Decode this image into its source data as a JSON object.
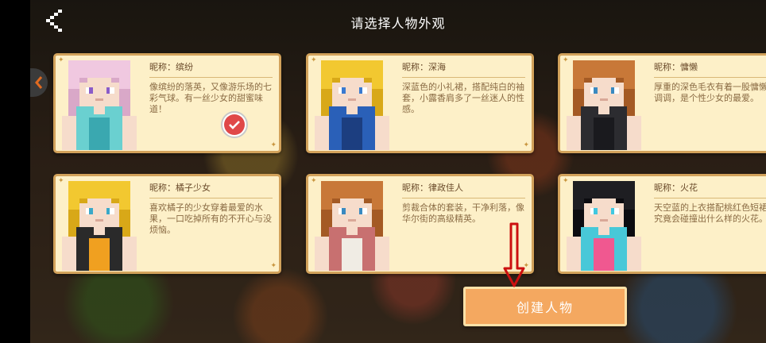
{
  "header": {
    "title": "请选择人物外观"
  },
  "characters": [
    {
      "nick": "昵称：缤纷",
      "desc": "像缤纷的落英，又像游乐场的七彩气球。有一丝少女的甜蜜味道！",
      "selected": true,
      "hair": "#f0c8e0",
      "hair_dark": "#d9a8c8",
      "skin": "#f6dccb",
      "eye": "#8a5cc8",
      "top": "#6ad0d0",
      "top_dark": "#3aa8b0"
    },
    {
      "nick": "昵称：深海",
      "desc": "深蓝色的小礼裙，搭配纯白的袖套，小露香肩多了一丝迷人的性感。",
      "selected": false,
      "hair": "#f2c830",
      "hair_dark": "#d8a818",
      "skin": "#f6dccb",
      "eye": "#3a7ad0",
      "top": "#2a60b8",
      "top_dark": "#1c3e80"
    },
    {
      "nick": "昵称：慵懒",
      "desc": "厚重的深色毛衣有着一股慵懒的调调，是个性少女的最爱。",
      "selected": false,
      "hair": "#c87838",
      "hair_dark": "#a45a24",
      "skin": "#f6dccb",
      "eye": "#3a8ac0",
      "top": "#2c2c30",
      "top_dark": "#1a1a1e"
    },
    {
      "nick": "昵称：橘子少女",
      "desc": "喜欢橘子的少女穿着最爱的水果，一口吃掉所有的不开心与没烦恼。",
      "selected": false,
      "hair": "#f2c830",
      "hair_dark": "#d8a818",
      "skin": "#f6dccb",
      "eye": "#3aa8c8",
      "top": "#2a2a2a",
      "top_dark": "#f0a020"
    },
    {
      "nick": "昵称：律政佳人",
      "desc": "剪裁合体的套装，干净利落，像华尔街的高级精英。",
      "selected": false,
      "hair": "#c87838",
      "hair_dark": "#a45a24",
      "skin": "#f6dccb",
      "eye": "#3a8ac0",
      "top": "#c87070",
      "top_dark": "#f0ece4"
    },
    {
      "nick": "昵称：火花",
      "desc": "天空蓝的上衣搭配桃红色短裙，究竟会碰撞出什么样的火花。",
      "selected": false,
      "hair": "#1e1e22",
      "hair_dark": "#0c0c10",
      "skin": "#f6dccb",
      "eye": "#40c8e0",
      "top": "#48c8d8",
      "top_dark": "#f05890"
    }
  ],
  "create_button": {
    "label": "创建人物"
  },
  "colors": {
    "card_bg": "#fdf0c8",
    "card_border": "#d2a25b",
    "button": "#f4a860",
    "check": "#e04848",
    "arrow": "#cc1010"
  },
  "icons": {
    "back": "back-chevron-icon",
    "check": "check-icon",
    "side": "pull-tab-icon",
    "arrow": "down-arrow-icon"
  }
}
